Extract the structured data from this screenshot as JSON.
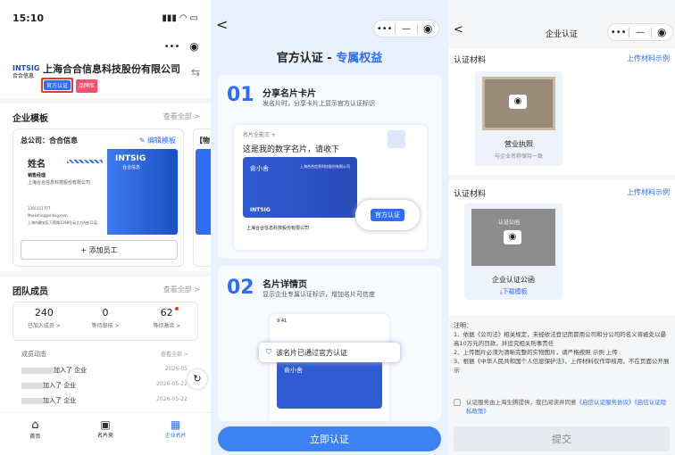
{
  "p1": {
    "time": "15:10",
    "company": "上海合合信息科技股份有限公司",
    "logo": "INTSIG",
    "logo_sub": "合合信息",
    "badge_official": "官方认证",
    "badge_brand": "品牌库",
    "switch_icon": "⇆",
    "template_title": "企业模板",
    "view_all": "查看全部 >",
    "hq": "总公司：合合信息",
    "edit_template": "✎ 编辑模板",
    "card_name": "姓名",
    "card_title": "销售经理",
    "card_company": "上海合合信息科技股份有限公司",
    "card_brand": "INTSIG",
    "card_brand_sub": "合合信息",
    "card_phone": "1391111777",
    "card_email": "Marketing@intsig.com",
    "card_addr": "上海市静安区万荣路1268号云立方A座11层",
    "second_tab": "【物",
    "add_staff": "+ 添加员工",
    "team_title": "团队成员",
    "team_view_all": "查看全部 >",
    "stats": [
      {
        "value": "240",
        "label": "已加入成员 >"
      },
      {
        "value": "0",
        "label": "等待审核 >"
      },
      {
        "value": "62",
        "label": "等待激活 >"
      }
    ],
    "activity_title": "成员动态",
    "activity_all": "查看全部 >",
    "activities": [
      {
        "text": "加入了 企业",
        "date": "2026-05"
      },
      {
        "text": "加入了 企业",
        "date": "2026-05-22"
      },
      {
        "text": "加入了 企业",
        "date": "2026-05-22"
      }
    ],
    "nav": [
      {
        "label": "首页"
      },
      {
        "label": "名片夹"
      },
      {
        "label": "企业名片"
      }
    ]
  },
  "p2": {
    "header_a": "官方认证 -",
    "header_b": "专属权益",
    "f1_num": "01",
    "f1_title": "分享名片卡片",
    "f1_desc": "发名片时，分享卡片上显示官方认证标识",
    "chat_name": "名片全能王 +",
    "chat_msg": "这是我的数字名片，请收下",
    "mini_name": "俞小舍",
    "mini_co": "上海合合信息科技股份有限公司",
    "mini_brand": "INTSIG",
    "mini_bottom": "上海合合信息科技股份有限公司",
    "verify_badge": "官方认证",
    "f2_num": "02",
    "f2_title": "名片详情页",
    "f2_desc": "显示企业专属认证标识，增加名片可信度",
    "phone_time": "9:41",
    "toast": "该名片已通过官方认证",
    "detail_name": "俞小舍",
    "cta": "立即认证"
  },
  "p3": {
    "title": "企业认证",
    "sec1": "认证材料",
    "sec1_link": "上传材料示例",
    "lic_title": "营业执照",
    "lic_sub": "与企业名称保持一致",
    "sec2": "认证材料",
    "sec2_link": "上传材料示例",
    "letter_label": "认证公函",
    "letter_title": "企业认证公函",
    "download": "下载模板",
    "notes_title": "注明：",
    "notes": [
      "1、依据《公司法》相关规定，未经依法登记而冒用公司和分公司的名义将被处以最高10万元的罚款，并追究相关刑事责任",
      "2、上传图片必须为清晰完整的实物图片，请严格按照 示例 上传",
      "3、根据《中华人民共和国个人信息保护法》，上传材料仅作审核用，不在页面公开展示"
    ],
    "agree_prefix": "认证服务由上海生腾提供，我已阅读并同意",
    "agree_link1": "《启信认证服务协议》",
    "agree_link2": "《启信认证隐私政策》",
    "submit": "提交"
  }
}
